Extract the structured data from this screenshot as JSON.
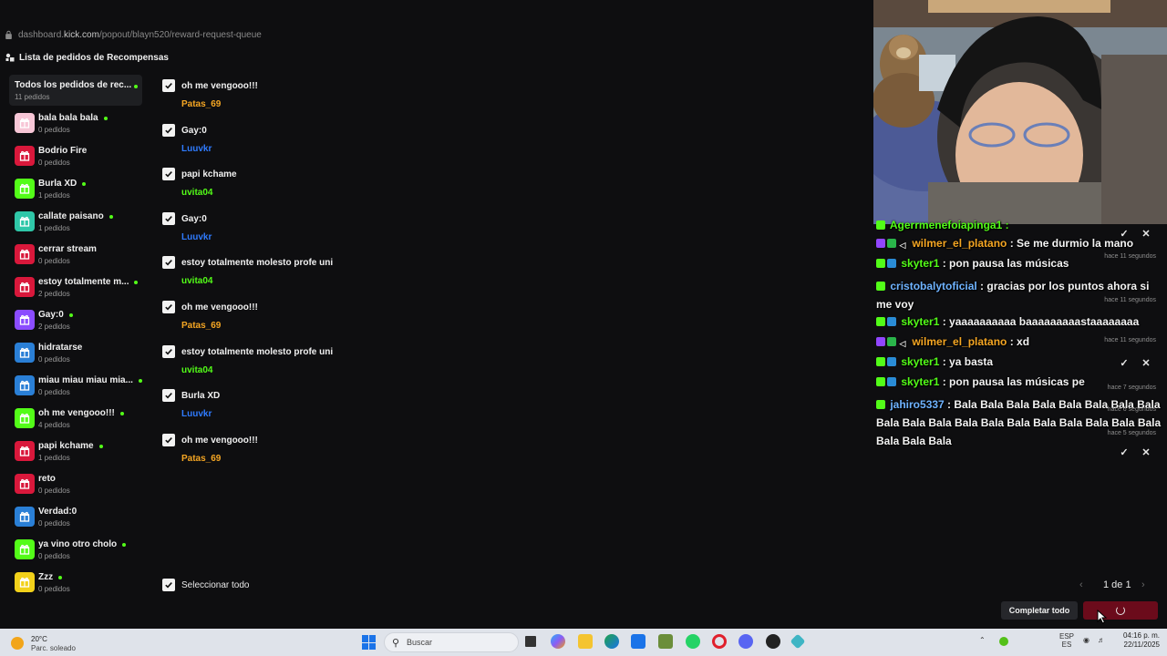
{
  "url": {
    "domain": "dashboard.kick.com",
    "path": "/popout/blayn520/reward-request-queue",
    "prefix": "dashboard."
  },
  "header": {
    "title": "Lista de pedidos de Recompensas"
  },
  "sidebar": {
    "all": {
      "label": "Todos los pedidos de rec...",
      "count": "11 pedidos"
    },
    "items": [
      {
        "label": "bala bala bala",
        "count": "0 pedidos",
        "color": "#f7c6d6",
        "dot": true
      },
      {
        "label": "Bodrio Fire",
        "count": "0 pedidos",
        "color": "#d9183b",
        "dot": false
      },
      {
        "label": "Burla XD",
        "count": "1 pedidos",
        "color": "#53fc18",
        "dot": true
      },
      {
        "label": "callate paisano",
        "count": "1 pedidos",
        "color": "#2fc7a8",
        "dot": true
      },
      {
        "label": "cerrar stream",
        "count": "0 pedidos",
        "color": "#d9183b",
        "dot": false
      },
      {
        "label": "estoy totalmente m...",
        "count": "2 pedidos",
        "color": "#d9183b",
        "dot": true
      },
      {
        "label": "Gay:0",
        "count": "2 pedidos",
        "color": "#8b4cff",
        "dot": true
      },
      {
        "label": "hidratarse",
        "count": "0 pedidos",
        "color": "#2a7fd6",
        "dot": false
      },
      {
        "label": "miau miau miau mia...",
        "count": "0 pedidos",
        "color": "#2a7fd6",
        "dot": true
      },
      {
        "label": "oh me vengooo!!!",
        "count": "4 pedidos",
        "color": "#53fc18",
        "dot": true
      },
      {
        "label": "papi kchame",
        "count": "1 pedidos",
        "color": "#d9183b",
        "dot": true
      },
      {
        "label": "reto",
        "count": "0 pedidos",
        "color": "#d9183b",
        "dot": false
      },
      {
        "label": "Verdad:0",
        "count": "0 pedidos",
        "color": "#2a7fd6",
        "dot": false
      },
      {
        "label": "ya vino otro cholo",
        "count": "0 pedidos",
        "color": "#53fc18",
        "dot": true
      },
      {
        "label": "Zzz",
        "count": "0 pedidos",
        "color": "#f2d11a",
        "dot": true
      }
    ]
  },
  "requests": [
    {
      "title": "oh me vengooo!!!",
      "user": "Patas_69",
      "user_color": "#f5a623"
    },
    {
      "title": "Gay:0",
      "user": "Luuvkr",
      "user_color": "#2f7bff"
    },
    {
      "title": "papi kchame",
      "user": "uvita04",
      "user_color": "#53fc18"
    },
    {
      "title": "Gay:0",
      "user": "Luuvkr",
      "user_color": "#2f7bff"
    },
    {
      "title": "estoy totalmente molesto profe uni",
      "user": "uvita04",
      "user_color": "#53fc18"
    },
    {
      "title": "oh me vengooo!!!",
      "user": "Patas_69",
      "user_color": "#f5a623"
    },
    {
      "title": "estoy totalmente molesto profe uni",
      "user": "uvita04",
      "user_color": "#53fc18"
    },
    {
      "title": "Burla XD",
      "user": "Luuvkr",
      "user_color": "#2f7bff"
    },
    {
      "title": "oh me vengooo!!!",
      "user": "Patas_69",
      "user_color": "#f5a623"
    }
  ],
  "footer": {
    "select_all": "Seleccionar todo",
    "pager": {
      "prev": "‹",
      "label": "1 de 1",
      "next": "›"
    },
    "complete_all": "Completar todo"
  },
  "chat": {
    "messages": [
      {
        "user": "Agerrmenefoiapinga1 :",
        "user_color": "#53fc18",
        "text": "",
        "badges": [
          "kick"
        ]
      },
      {
        "user": "wilmer_el_platano",
        "user_color": "#f5a623",
        "text": " : Se me durmio la mano",
        "badges": [
          "purple",
          "green2",
          "mute"
        ]
      },
      {
        "user": "skyter1",
        "user_color": "#53fc18",
        "text": " : pon pausa las músicas",
        "badges": [
          "kick",
          "blue"
        ]
      },
      {
        "user": "cristobalytoficial",
        "user_color": "#6fb3ff",
        "text": " : gracias por los puntos ahora si me voy",
        "badges": [
          "kick"
        ]
      },
      {
        "user": "skyter1",
        "user_color": "#53fc18",
        "text": " : yaaaaaaaaaa baaaaaaaaastaaaaaaaa",
        "badges": [
          "kick",
          "blue"
        ]
      },
      {
        "user": "wilmer_el_platano",
        "user_color": "#f5a623",
        "text": " : xd",
        "badges": [
          "purple",
          "green2",
          "mute"
        ]
      },
      {
        "user": "skyter1",
        "user_color": "#53fc18",
        "text": " : ya basta",
        "badges": [
          "kick",
          "blue"
        ]
      },
      {
        "user": "skyter1",
        "user_color": "#53fc18",
        "text": " : pon pausa las músicas pe",
        "badges": [
          "kick",
          "blue"
        ]
      },
      {
        "user": "jahiro5337",
        "user_color": "#6fb3ff",
        "text": " : Bala Bala Bala Bala Bala Bala Bala Bala Bala Bala Bala Bala Bala Bala Bala Bala Bala Bala Bala Bala Bala Bala",
        "badges": [
          "kick"
        ]
      }
    ],
    "timestamps": [
      "hace 11 segundos",
      "hace 11 segundos",
      "hace 11 segundos",
      "hace 7 segundos",
      "hace 6 segundos",
      "hace 5 segundos"
    ]
  },
  "taskbar": {
    "weather_temp": "20°C",
    "weather_desc": "Parc. soleado",
    "search_placeholder": "Buscar",
    "lang": "ESP",
    "lang_sub": "ES",
    "time": "04:16 p. m.",
    "date": "22/11/2025"
  }
}
